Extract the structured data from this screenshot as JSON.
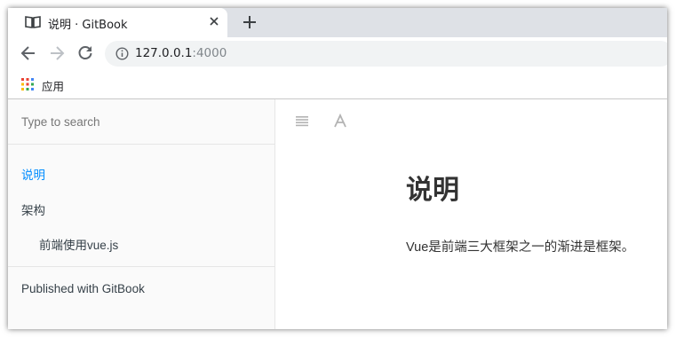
{
  "browser": {
    "tab": {
      "title": "说明 · GitBook"
    },
    "address": {
      "host": "127.0.0.1",
      "port": ":4000"
    },
    "bookmarks": {
      "apps_label": "应用"
    }
  },
  "sidebar": {
    "search_placeholder": "Type to search",
    "items": [
      {
        "label": "说明",
        "active": true
      },
      {
        "label": "架构",
        "active": false
      },
      {
        "label": "前端使用vue.js",
        "active": false
      }
    ],
    "published": "Published with GitBook"
  },
  "page": {
    "title": "说明",
    "text": "Vue是前端三大框架之一的渐进是框架。"
  },
  "colors": {
    "link_active": "#008cff",
    "text": "#364149"
  }
}
